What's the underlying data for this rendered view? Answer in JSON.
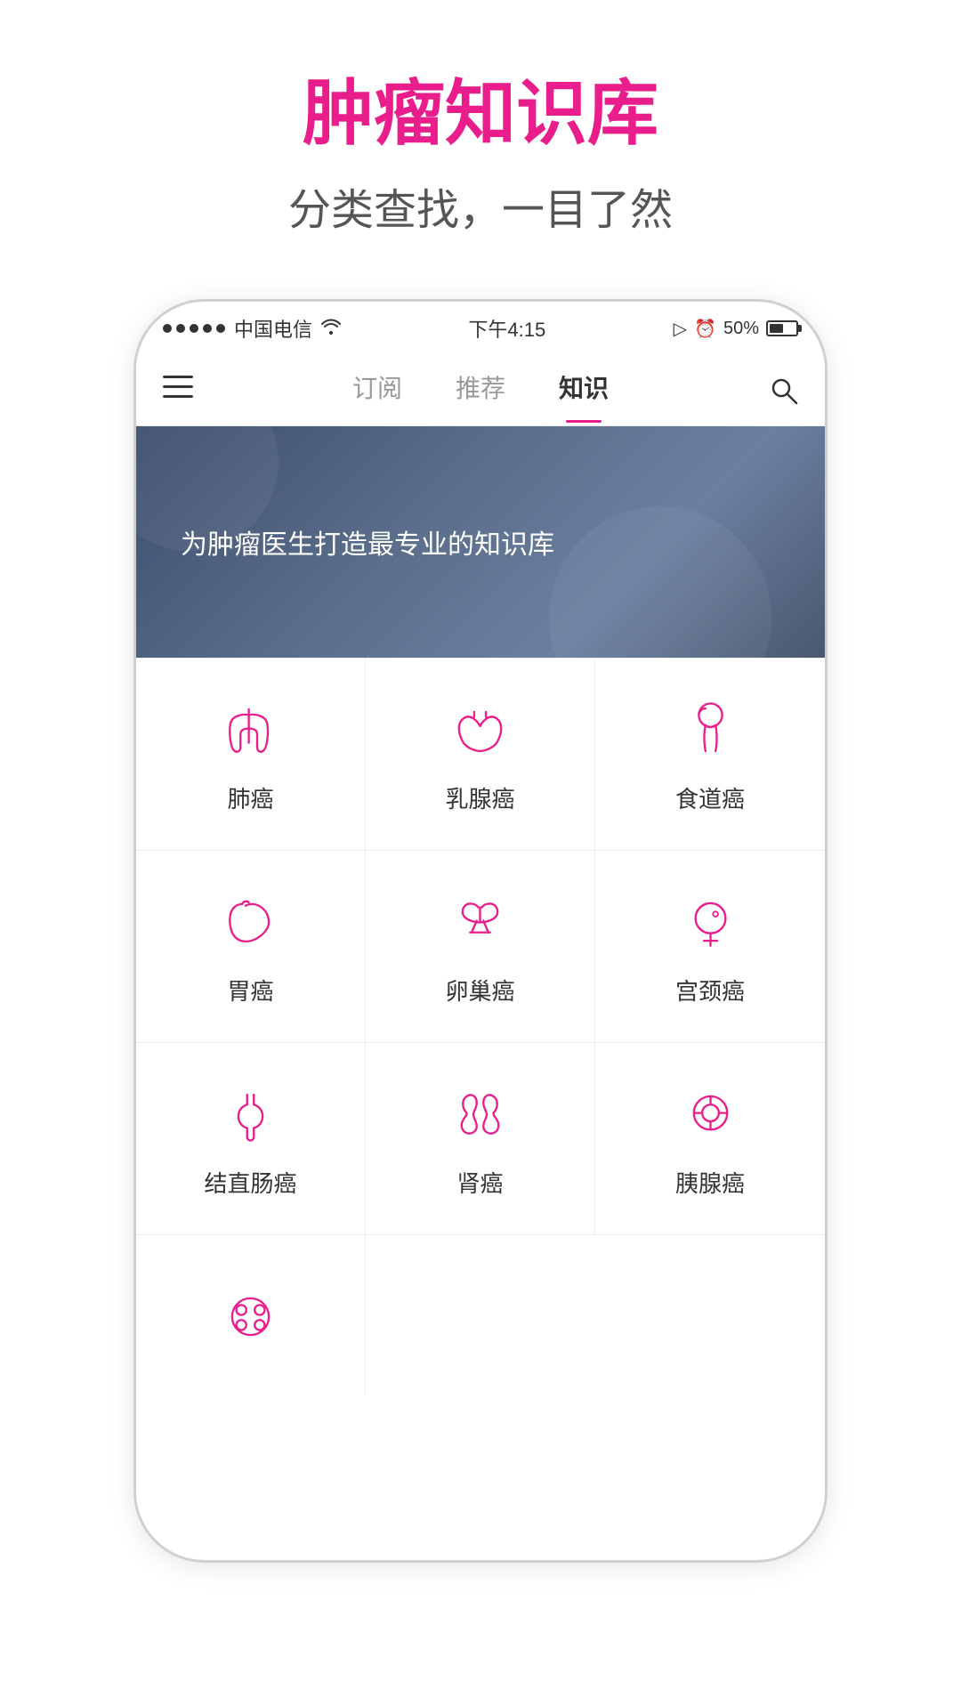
{
  "page": {
    "title": "肿瘤知识库",
    "subtitle": "分类查找，一目了然"
  },
  "statusBar": {
    "carrier": "中国电信",
    "time": "下午4:15",
    "battery": "50%"
  },
  "nav": {
    "tabs": [
      "订阅",
      "推荐",
      "知识"
    ],
    "activeTab": "知识"
  },
  "banner": {
    "text": "为肿瘤医生打造最专业的知识库"
  },
  "cancerTypes": [
    {
      "id": "lung",
      "label": "肺癌",
      "icon": "lung"
    },
    {
      "id": "breast",
      "label": "乳腺癌",
      "icon": "breast"
    },
    {
      "id": "esophagus",
      "label": "食道癌",
      "icon": "esophagus"
    },
    {
      "id": "stomach",
      "label": "胃癌",
      "icon": "stomach"
    },
    {
      "id": "ovary",
      "label": "卵巢癌",
      "icon": "ovary"
    },
    {
      "id": "cervix",
      "label": "宫颈癌",
      "icon": "cervix"
    },
    {
      "id": "colorectal",
      "label": "结直肠癌",
      "icon": "colorectal"
    },
    {
      "id": "kidney",
      "label": "肾癌",
      "icon": "kidney"
    },
    {
      "id": "pancreas",
      "label": "胰腺癌",
      "icon": "pancreas"
    },
    {
      "id": "other",
      "label": "",
      "icon": "nodes"
    }
  ],
  "colors": {
    "pink": "#e91e8c",
    "navy": "#3d4e6e"
  }
}
